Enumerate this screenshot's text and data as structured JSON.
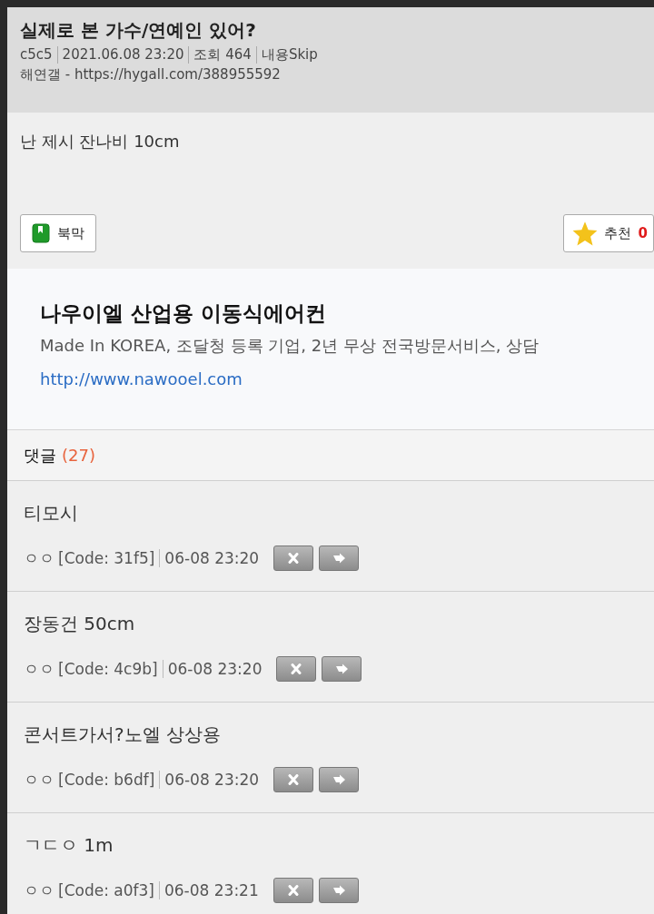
{
  "post": {
    "title": "실제로 본 가수/연예인 있어?",
    "meta": [
      "c5c5",
      "2021.06.08 23:20",
      "조회 464",
      "내용Skip"
    ],
    "source": "해연갤 - https://hygall.com/388955592",
    "body": "난 제시 잔나비 10cm"
  },
  "actions": {
    "bookmark": "북막",
    "recommend": "추천",
    "recommend_count": "0"
  },
  "ad": {
    "title": "나우이엘 산업용 이동식에어컨",
    "description": "Made In KOREA, 조달청 등록 기업, 2년 무상 전국방문서비스, 상담",
    "link": "http://www.nawooel.com"
  },
  "comments_header": {
    "label": "댓글",
    "count": "(27)"
  },
  "comments": [
    {
      "text": "티모시",
      "author": "ㅇㅇ",
      "code": "[Code: 31f5]",
      "time": "06-08 23:20"
    },
    {
      "text": "장동건 50cm",
      "author": "ㅇㅇ",
      "code": "[Code: 4c9b]",
      "time": "06-08 23:20"
    },
    {
      "text": "콘서트가서?노엘 상상용",
      "author": "ㅇㅇ",
      "code": "[Code: b6df]",
      "time": "06-08 23:20"
    },
    {
      "text": "ㄱㄷㅇ 1m",
      "author": "ㅇㅇ",
      "code": "[Code: a0f3]",
      "time": "06-08 23:21"
    }
  ]
}
